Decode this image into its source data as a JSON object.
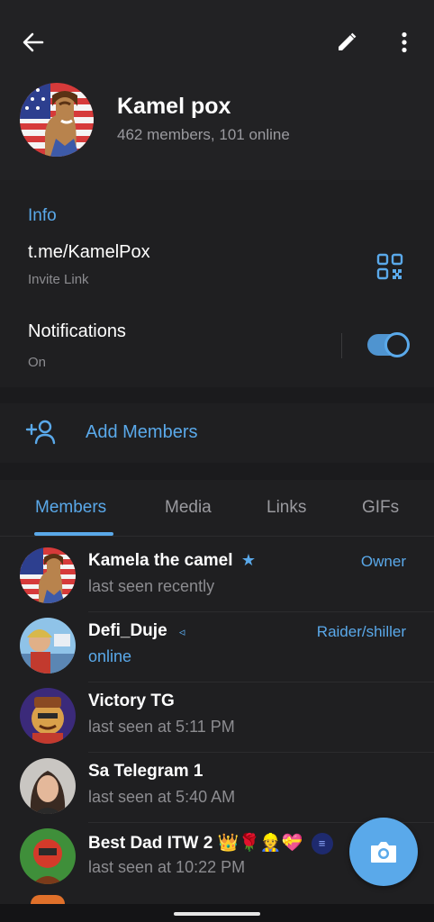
{
  "header": {
    "title": "Kamel pox",
    "subtitle": "462 members, 101 online"
  },
  "icons": {
    "back": "arrow-left-icon",
    "edit": "pencil-icon",
    "more": "vertical-dots-icon",
    "qr": "qr-code-icon",
    "add_member": "add-person-icon",
    "camera": "camera-icon",
    "star": "star-icon"
  },
  "info": {
    "heading": "Info",
    "link": "t.me/KamelPox",
    "link_caption": "Invite Link",
    "notifications_label": "Notifications",
    "notifications_value": "On",
    "notifications_enabled": true
  },
  "add_members": {
    "label": "Add Members"
  },
  "tabs": [
    {
      "label": "Members",
      "active": true
    },
    {
      "label": "Media",
      "active": false
    },
    {
      "label": "Links",
      "active": false
    },
    {
      "label": "GIFs",
      "active": false
    }
  ],
  "members": [
    {
      "name": "Kamela the camel",
      "badge": "★",
      "status": "last seen recently",
      "online": false,
      "role": "Owner"
    },
    {
      "name": "Defi_Duje",
      "badge": "◃",
      "status": "online",
      "online": true,
      "role": "Raider/shiller"
    },
    {
      "name": "Victory TG",
      "badge": "",
      "status": "last seen at 5:11 PM",
      "online": false,
      "role": ""
    },
    {
      "name": "Sa Telegram 1",
      "badge": "",
      "status": "last seen at 5:40 AM",
      "online": false,
      "role": ""
    },
    {
      "name": "Best Dad ITW 2 👑🌹👷💝",
      "badge": "",
      "status": "last seen at 10:22 PM",
      "online": false,
      "role": ""
    }
  ],
  "colors": {
    "accent": "#5aa9ea",
    "background": "#1b1b1d",
    "surface": "#1f1f21",
    "header": "#222224"
  }
}
